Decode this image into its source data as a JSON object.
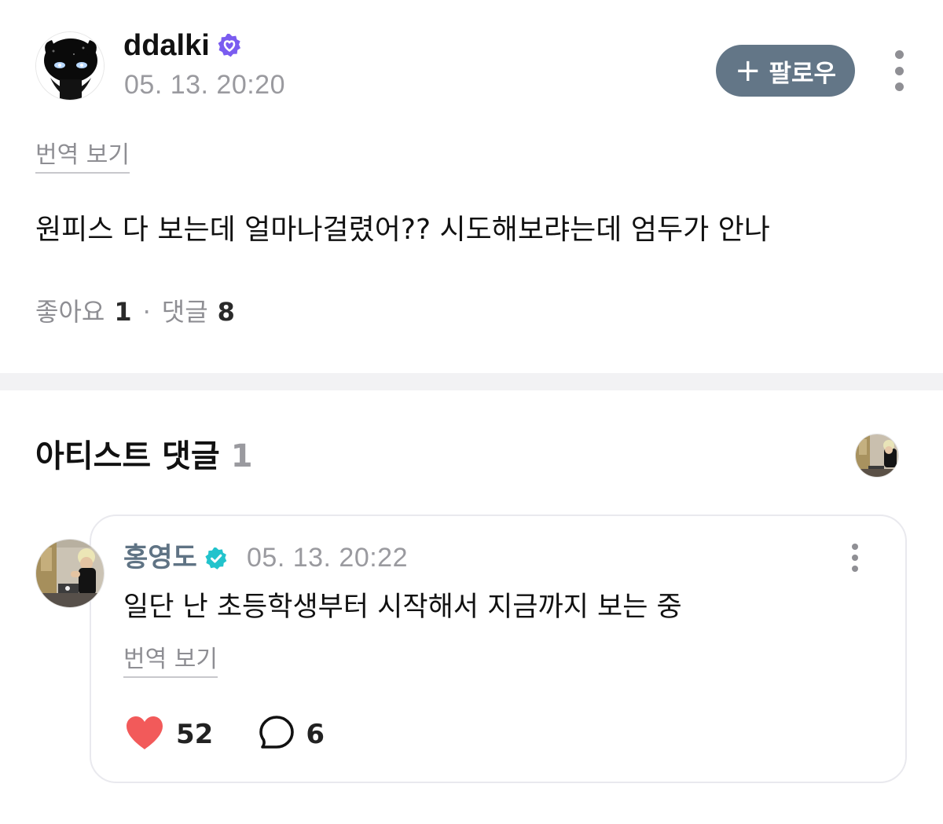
{
  "post": {
    "author": "ddalki",
    "author_verified_icon": "verified-heart-badge-icon",
    "date": "05. 13. 20:20",
    "follow_button": {
      "icon": "+",
      "label": "팔로우"
    },
    "more_icon": "more-vertical-icon",
    "translate_label": "번역 보기",
    "text": "원피스 다 보는데 얼마나걸렸어?? 시도해보랴는데 엄두가 안나",
    "stats": {
      "likes_label": "좋아요",
      "likes_count": "1",
      "separator": "·",
      "comments_label": "댓글",
      "comments_count": "8"
    }
  },
  "artist_comments": {
    "title": "아티스트 댓글",
    "count": "1",
    "comments": [
      {
        "author": "홍영도",
        "author_verified_icon": "verified-check-badge-icon",
        "date": "05. 13. 20:22",
        "text": "일단 난 초등학생부터 시작해서 지금까지 보는 중",
        "translate_label": "번역 보기",
        "likes": "52",
        "replies": "6",
        "like_icon": "heart-icon",
        "reply_icon": "comment-bubble-icon"
      }
    ]
  },
  "colors": {
    "follow_bg": "#637687",
    "artist_name": "#5f7384",
    "heart": "#f25a5a",
    "badge_purple": "#7a5cf0",
    "badge_teal": "#22c3cc",
    "secondary_text": "#9a9a9f"
  }
}
